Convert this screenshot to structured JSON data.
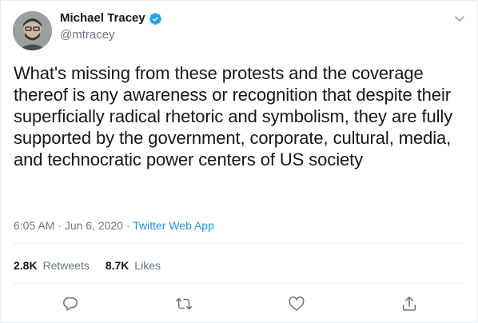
{
  "author": {
    "name": "Michael Tracey",
    "handle": "@mtracey",
    "verified": true,
    "verified_color": "#1da1f2"
  },
  "tweet": {
    "text": "What's missing from these protests and the coverage thereof is any awareness or recognition that despite their superficially radical rhetoric and symbolism, they are fully supported by the government, corporate, cultural, media, and technocratic power centers of US society",
    "time": "6:05 AM",
    "date": "Jun 6, 2020",
    "separator": "·",
    "source": "Twitter Web App"
  },
  "stats": {
    "retweets_count": "2.8K",
    "retweets_label": "Retweets",
    "likes_count": "8.7K",
    "likes_label": "Likes"
  },
  "actions": [
    "reply-icon",
    "retweet-icon",
    "like-icon",
    "share-icon"
  ],
  "colors": {
    "text": "#14171a",
    "secondary": "#657786",
    "link": "#1b95e0",
    "border": "#e6ecf0"
  }
}
